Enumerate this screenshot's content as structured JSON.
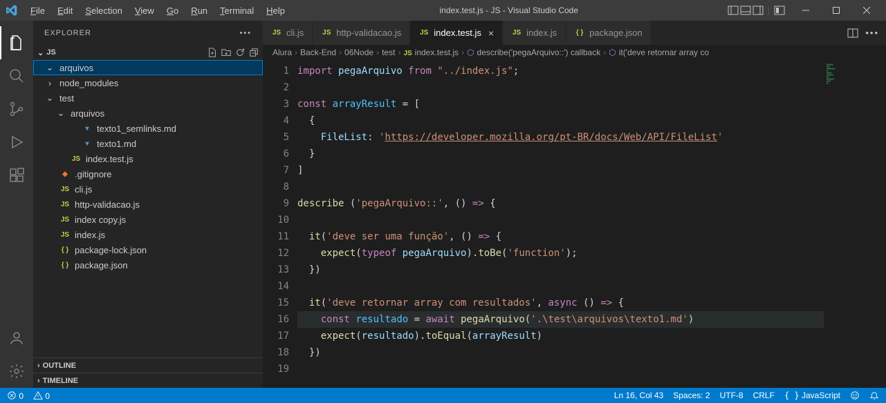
{
  "title": "index.test.js - JS - Visual Studio Code",
  "menu": [
    "File",
    "Edit",
    "Selection",
    "View",
    "Go",
    "Run",
    "Terminal",
    "Help"
  ],
  "explorer": {
    "title": "EXPLORER",
    "root": "JS",
    "outline": "OUTLINE",
    "timeline": "TIMELINE",
    "tree": [
      {
        "depth": 1,
        "kind": "folder",
        "open": true,
        "label": "arquivos",
        "selected": true
      },
      {
        "depth": 1,
        "kind": "folder",
        "open": false,
        "label": "node_modules"
      },
      {
        "depth": 1,
        "kind": "folder",
        "open": true,
        "label": "test"
      },
      {
        "depth": 2,
        "kind": "folder",
        "open": true,
        "label": "arquivos"
      },
      {
        "depth": 3,
        "kind": "file",
        "ico": "md",
        "label": "texto1_semlinks.md"
      },
      {
        "depth": 3,
        "kind": "file",
        "ico": "md",
        "label": "texto1.md"
      },
      {
        "depth": 2,
        "kind": "file",
        "ico": "js",
        "label": "index.test.js"
      },
      {
        "depth": 1,
        "kind": "file",
        "ico": "git",
        "label": ".gitignore"
      },
      {
        "depth": 1,
        "kind": "file",
        "ico": "js",
        "label": "cli.js"
      },
      {
        "depth": 1,
        "kind": "file",
        "ico": "js",
        "label": "http-validacao.js"
      },
      {
        "depth": 1,
        "kind": "file",
        "ico": "js",
        "label": "index copy.js"
      },
      {
        "depth": 1,
        "kind": "file",
        "ico": "js",
        "label": "index.js"
      },
      {
        "depth": 1,
        "kind": "file",
        "ico": "json",
        "label": "package-lock.json"
      },
      {
        "depth": 1,
        "kind": "file",
        "ico": "json",
        "label": "package.json"
      }
    ]
  },
  "tabs": [
    {
      "ico": "js",
      "label": "cli.js",
      "active": false
    },
    {
      "ico": "js",
      "label": "http-validacao.js",
      "active": false
    },
    {
      "ico": "js",
      "label": "index.test.js",
      "active": true
    },
    {
      "ico": "js",
      "label": "index.js",
      "active": false
    },
    {
      "ico": "json",
      "label": "package.json",
      "active": false
    }
  ],
  "breadcrumbs": [
    "Alura",
    "Back-End",
    "06Node",
    "test",
    "index.test.js",
    "describe('pegaArquivo::') callback",
    "it('deve retornar array co"
  ],
  "code_lines": [
    {
      "n": 1,
      "html": "<span class='tok-kw'>import</span> <span class='tok-var'>pegaArquivo</span> <span class='tok-kw'>from</span> <span class='tok-str'>\"../index.js\"</span><span class='tok-op'>;</span>"
    },
    {
      "n": 2,
      "html": ""
    },
    {
      "n": 3,
      "html": "<span class='tok-kw'>const</span> <span class='tok-const'>arrayResult</span> <span class='tok-op'>=</span> <span class='tok-op'>[</span>"
    },
    {
      "n": 4,
      "html": "  <span class='tok-op'>{</span>"
    },
    {
      "n": 5,
      "html": "    <span class='tok-var'>FileList</span><span class='tok-op'>:</span> <span class='tok-str'>'</span><span class='tok-url'>https://developer.mozilla.org/pt-BR/docs/Web/API/FileList</span><span class='tok-str'>'</span>"
    },
    {
      "n": 6,
      "html": "  <span class='tok-op'>}</span>"
    },
    {
      "n": 7,
      "html": "<span class='tok-op'>]</span>"
    },
    {
      "n": 8,
      "html": ""
    },
    {
      "n": 9,
      "html": "<span class='tok-fn'>describe</span> <span class='tok-op'>(</span><span class='tok-str'>'pegaArquivo::'</span><span class='tok-op'>, () </span><span class='tok-kw'>=&gt;</span><span class='tok-op'> {</span>"
    },
    {
      "n": 10,
      "html": ""
    },
    {
      "n": 11,
      "html": "  <span class='tok-fn'>it</span><span class='tok-op'>(</span><span class='tok-str'>'deve ser uma função'</span><span class='tok-op'>, () </span><span class='tok-kw'>=&gt;</span><span class='tok-op'> {</span>"
    },
    {
      "n": 12,
      "html": "    <span class='tok-fn'>expect</span><span class='tok-op'>(</span><span class='tok-kw'>typeof</span> <span class='tok-var'>pegaArquivo</span><span class='tok-op'>).</span><span class='tok-fn'>toBe</span><span class='tok-op'>(</span><span class='tok-str'>'function'</span><span class='tok-op'>);</span>"
    },
    {
      "n": 13,
      "html": "  <span class='tok-op'>})</span>"
    },
    {
      "n": 14,
      "html": ""
    },
    {
      "n": 15,
      "html": "  <span class='tok-fn'>it</span><span class='tok-op'>(</span><span class='tok-str'>'deve retornar array com resultados'</span><span class='tok-op'>, </span><span class='tok-kw'>async</span><span class='tok-op'> () </span><span class='tok-kw'>=&gt;</span><span class='tok-op'> {</span>"
    },
    {
      "n": 16,
      "html": "    <span class='tok-kw'>const</span> <span class='tok-const'>resultado</span> <span class='tok-op'>=</span> <span class='tok-kw'>await</span> <span class='tok-fn'>pegaArquivo</span><span class='tok-op'>(</span><span class='tok-str'>'.\\test\\arquivos\\texto1.md'</span><span class='tok-op'>)</span>",
      "hl": true
    },
    {
      "n": 17,
      "html": "    <span class='tok-fn'>expect</span><span class='tok-op'>(</span><span class='tok-var'>resultado</span><span class='tok-op'>).</span><span class='tok-fn'>toEqual</span><span class='tok-op'>(</span><span class='tok-var'>arrayResult</span><span class='tok-op'>)</span>"
    },
    {
      "n": 18,
      "html": "  <span class='tok-op'>})</span>"
    },
    {
      "n": 19,
      "html": ""
    }
  ],
  "status": {
    "errors": "0",
    "warnings": "0",
    "lncol": "Ln 16, Col 43",
    "spaces": "Spaces: 2",
    "encoding": "UTF-8",
    "eol": "CRLF",
    "lang": "JavaScript"
  }
}
